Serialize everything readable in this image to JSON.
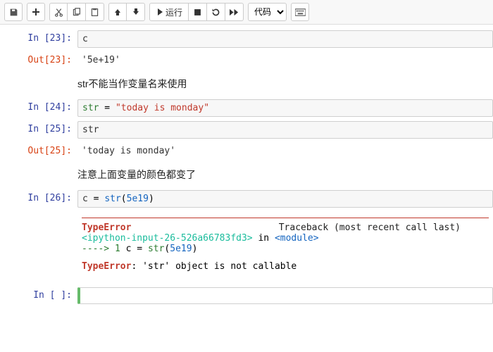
{
  "toolbar": {
    "run_label": "运行",
    "celltype_selected": "代码"
  },
  "cells": [
    {
      "in_prompt": "In  [23]:",
      "code_plain": "c"
    },
    {
      "out_prompt": "Out[23]:",
      "output": "'5e+19'"
    },
    {
      "md": "str不能当作变量名来使用"
    },
    {
      "in_prompt": "In  [24]:",
      "assign_lhs": "str",
      "eq": " = ",
      "assign_str": "\"today is monday\""
    },
    {
      "in_prompt": "In  [25]:",
      "code_plain": "str"
    },
    {
      "out_prompt": "Out[25]:",
      "output": "'today is monday'"
    },
    {
      "md": "注意上面变量的颜色都变了"
    },
    {
      "in_prompt": "In  [26]:",
      "assign_lhs": "c",
      "eq": " = ",
      "call_fn": "str",
      "call_open": "(",
      "call_arg": "5e19",
      "call_close": ")"
    },
    {
      "error": {
        "name": "TypeError",
        "header_right": "Traceback (most recent call last)",
        "loc_file": "<ipython-input-26-526a66783fd3>",
        "loc_in": " in ",
        "loc_mod": "<module>",
        "arrow": "----> 1 ",
        "line_lhs": "c ",
        "line_eq": "= ",
        "line_fn": "str",
        "line_open": "(",
        "line_arg": "5e19",
        "line_close": ")",
        "final_name": "TypeError",
        "final_msg": ": 'str' object is not callable"
      }
    },
    {
      "in_prompt": "In  [  ]:",
      "code_plain": ""
    }
  ]
}
